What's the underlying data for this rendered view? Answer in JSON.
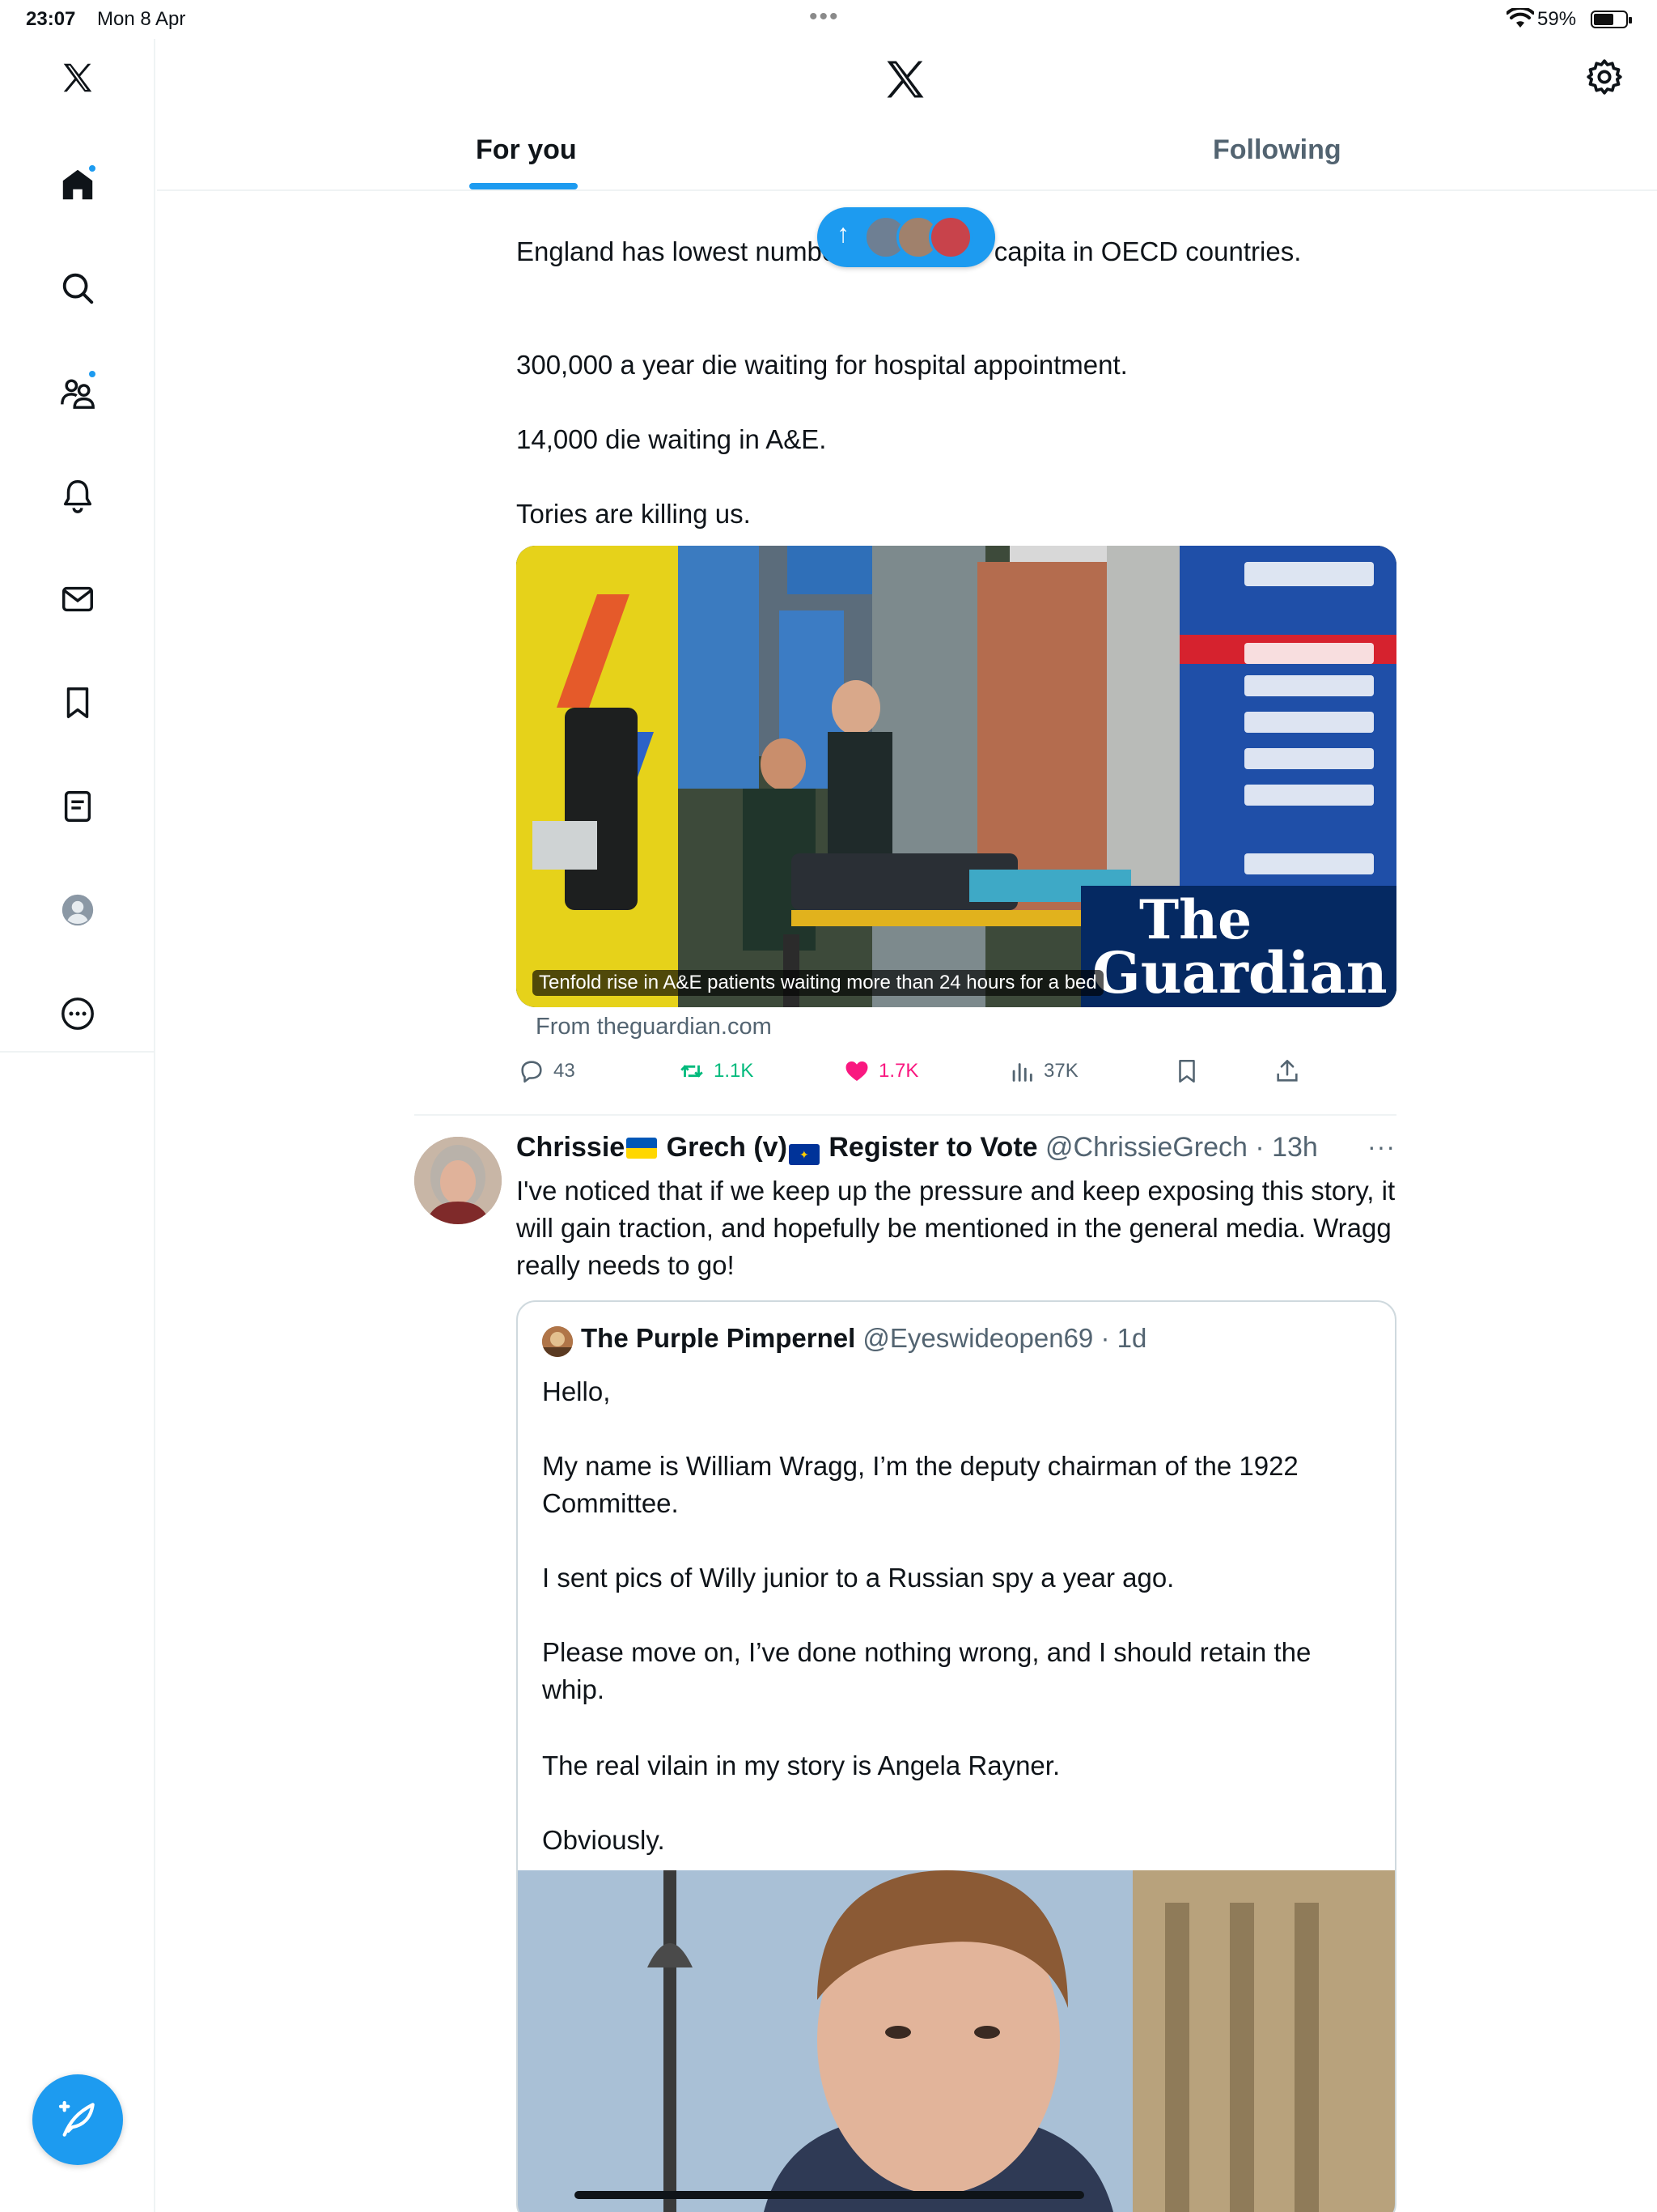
{
  "status_bar": {
    "time": "23:07",
    "date": "Mon 8 Apr",
    "battery": "59%"
  },
  "header": {
    "tabs": [
      {
        "label": "For you",
        "selected": true
      },
      {
        "label": "Following",
        "selected": false
      }
    ]
  },
  "sidebar": {
    "items": [
      {
        "name": "home",
        "icon": "home-icon",
        "has_dot": true
      },
      {
        "name": "explore",
        "icon": "search-icon",
        "has_dot": false
      },
      {
        "name": "communities",
        "icon": "communities-icon",
        "has_dot": true
      },
      {
        "name": "notifications",
        "icon": "bell-icon",
        "has_dot": false
      },
      {
        "name": "messages",
        "icon": "mail-icon",
        "has_dot": false
      },
      {
        "name": "bookmarks",
        "icon": "bookmark-icon",
        "has_dot": false
      },
      {
        "name": "lists",
        "icon": "list-icon",
        "has_dot": false
      },
      {
        "name": "profile",
        "icon": "profile-icon",
        "has_dot": false
      },
      {
        "name": "more",
        "icon": "more-icon",
        "has_dot": false
      }
    ],
    "accent": "#1d9bf0"
  },
  "post1": {
    "lines": [
      "England has lowest number of beds per capita in OECD countries.",
      "300,000 a year die waiting for hospital appointment.",
      "14,000 die waiting in A&E.",
      "Tories are killing us."
    ],
    "card": {
      "caption": "Tenfold rise in A&E patients waiting more than 24 hours for a bed",
      "source": "From theguardian.com",
      "logo_line1": "The",
      "logo_line2": "Guardian"
    },
    "actions": {
      "replies": "43",
      "reposts": "1.1K",
      "likes": "1.7K",
      "views": "37K"
    }
  },
  "post2": {
    "name_part1": "Chrissie",
    "name_part2": "Grech (v)",
    "name_part3": "Register to Vote",
    "handle_time": "@ChrissieGrech · 13h",
    "text": "I've noticed that if we keep up the pressure and keep exposing this story, it will gain traction, and hopefully be mentioned in the general media. Wragg really needs to go!",
    "quote": {
      "name": "The Purple Pimpernel",
      "handle_time": "@Eyeswideopen69 · 1d",
      "paragraphs": [
        "Hello,",
        "My name is William Wragg, I’m the deputy chairman of the 1922 Committee.",
        "I sent pics of Willy junior to a Russian spy a year ago.",
        "Please move on, I’ve done nothing wrong, and I should retain the whip.",
        "The real vilain in my story is Angela Rayner.",
        "Obviously."
      ]
    }
  },
  "colors": {
    "accent": "#1d9bf0",
    "repost": "#00ba7c",
    "like": "#f91880",
    "secondary_text": "#536471"
  }
}
